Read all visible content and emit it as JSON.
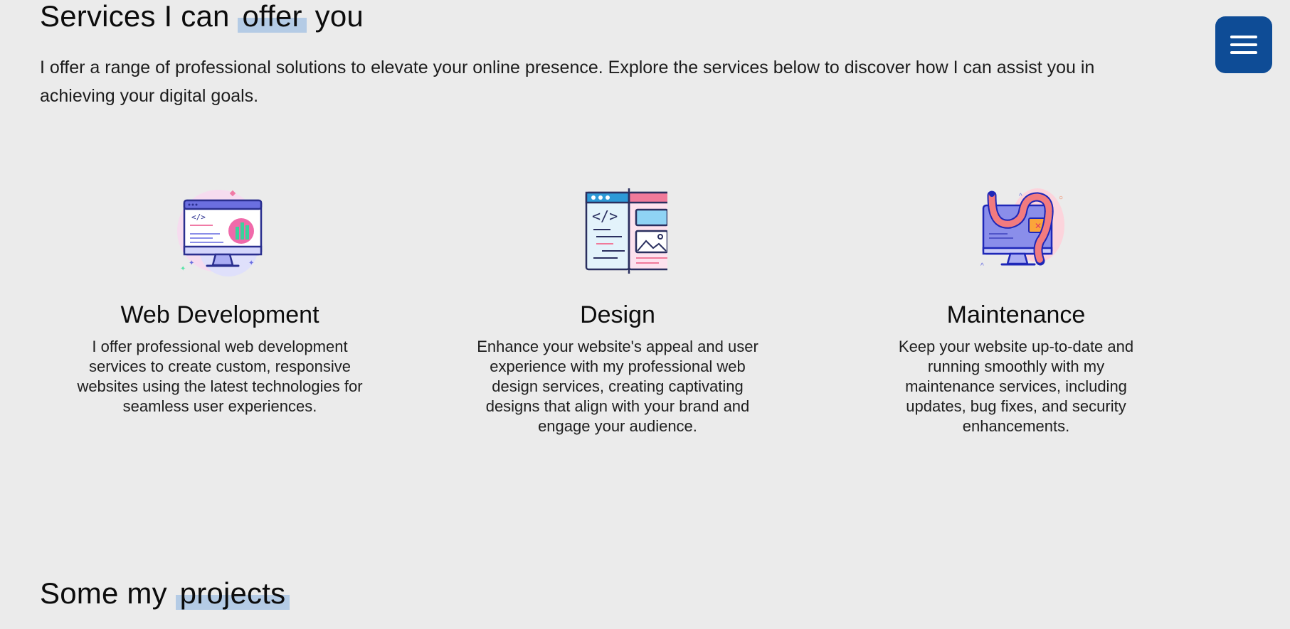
{
  "services_section": {
    "title_before": "Services I can",
    "title_highlight": "offer",
    "title_after": "you",
    "intro": "I offer a range of professional solutions to elevate your online presence. Explore the services below to discover how I can assist you in achieving your digital goals."
  },
  "menu_button": {
    "icon": "hamburger-menu-icon",
    "color": "#0e4c96"
  },
  "services": [
    {
      "icon": "monitor-code-icon",
      "title": "Web Development",
      "description": "I offer professional web development services to create custom, responsive websites using the latest technologies for seamless user experiences."
    },
    {
      "icon": "web-layout-design-icon",
      "title": "Design",
      "description": "Enhance your website's appeal and user experience with my professional web design services, creating captivating designs that align with your brand and engage your audience."
    },
    {
      "icon": "monitor-bug-maintenance-icon",
      "title": "Maintenance",
      "description": "Keep your website up-to-date and running smoothly with my maintenance services, including updates, bug fixes, and security enhancements."
    }
  ],
  "projects_section": {
    "title_before": "Some my",
    "title_highlight": "projects"
  },
  "colors": {
    "background": "#ebebeb",
    "highlight": "#b4cbe5",
    "accent": "#0e4c96"
  }
}
